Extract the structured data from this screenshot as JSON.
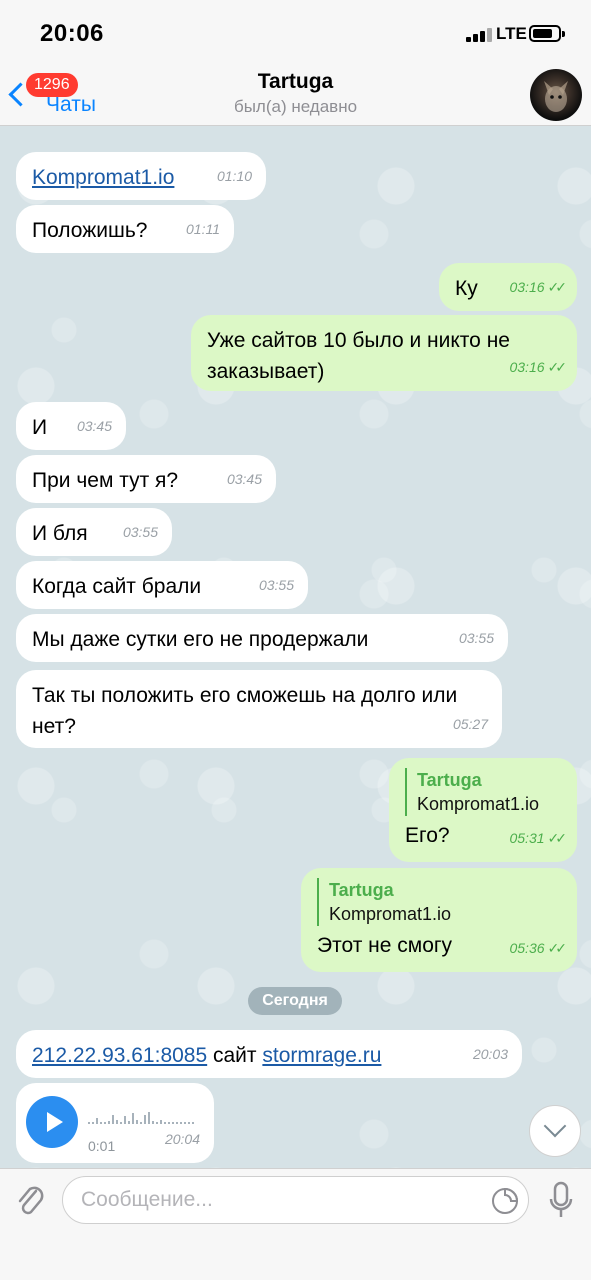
{
  "status": {
    "time": "20:06",
    "network": "LTE"
  },
  "nav": {
    "back_label": "Чаты",
    "unread_badge": "1296",
    "title": "Tartuga",
    "subtitle": "был(а) недавно"
  },
  "messages": [
    {
      "dir": "in",
      "link": "Kompromat1.io",
      "time": "01:10"
    },
    {
      "dir": "in",
      "text": "Положишь?",
      "time": "01:11"
    },
    {
      "dir": "out",
      "text": "Ку",
      "time": "03:16"
    },
    {
      "dir": "out",
      "text": "Уже сайтов 10 было и никто не заказывает)",
      "time": "03:16"
    },
    {
      "dir": "in",
      "text": "И",
      "time": "03:45"
    },
    {
      "dir": "in",
      "text": "При чем тут я?",
      "time": "03:45"
    },
    {
      "dir": "in",
      "text": "И бля",
      "time": "03:55"
    },
    {
      "dir": "in",
      "text": "Когда сайт брали",
      "time": "03:55"
    },
    {
      "dir": "in",
      "text": "Мы даже сутки его не продержали",
      "time": "03:55"
    },
    {
      "dir": "in",
      "text": "Так ты положить его сможешь на долго или нет?",
      "time": "05:27"
    },
    {
      "dir": "out",
      "reply_name": "Tartuga",
      "reply_text": "Kompromat1.io",
      "text": "Его?",
      "time": "05:31"
    },
    {
      "dir": "out",
      "reply_name": "Tartuga",
      "reply_text": "Kompromat1.io",
      "text": "Этот не смогу",
      "time": "05:36"
    },
    {
      "dir": "in",
      "link1": "212.22.93.61:8085",
      "mid": " сайт ",
      "link2": "stormrage.ru",
      "time": "20:03"
    },
    {
      "dir": "in",
      "type": "voice",
      "duration": "0:01",
      "time": "20:04"
    }
  ],
  "date_separator": "Сегодня",
  "read_mark": "✓✓",
  "input": {
    "placeholder": "Сообщение..."
  },
  "icons": [
    "back-chevron-icon",
    "attach-icon",
    "sticker-icon",
    "mic-icon",
    "play-icon",
    "scroll-down-icon",
    "signal-icon",
    "battery-icon"
  ],
  "colors": {
    "accent": "#0a84ff",
    "outgoing_bubble": "#dcf8c6",
    "incoming_bubble": "#ffffff",
    "badge": "#ff3b30",
    "read_check": "#4cae4c"
  }
}
